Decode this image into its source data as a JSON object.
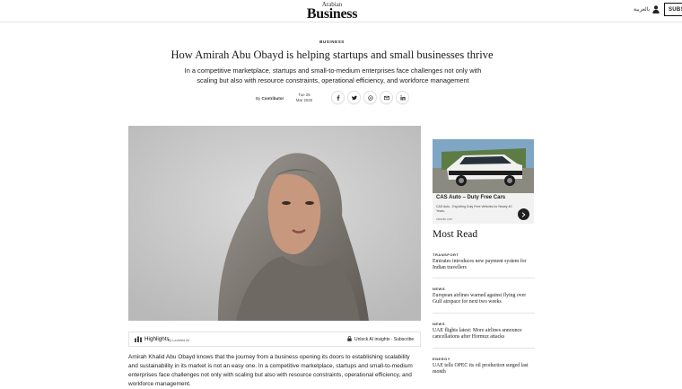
{
  "header": {
    "logo_line1": "Arabian",
    "logo_line2": "Business",
    "language_link": "بالعربية",
    "subscribe_label": "SUBS"
  },
  "article": {
    "category": "BUSINESS",
    "title": "How Amirah Abu Obayd is helping startups and small businesses thrive",
    "dek": "In a competitive marketplace, startups and small-to-medium enterprises face challenges not only with scaling but also with resource constraints, operational efficiency, and workforce management",
    "byline_prefix": "By",
    "author": "Contributor",
    "date_line1": "Tue 25",
    "date_line2": "Mar 2025",
    "share": [
      "facebook-icon",
      "twitter-icon",
      "whatsapp-icon",
      "email-icon",
      "linkedin-icon"
    ]
  },
  "highlights": {
    "label": "Highlights",
    "by": "by Leveled AI",
    "unlock": "Unlock AI insights · Subscribe"
  },
  "body_text": "Amirah Khalid Abu Obayd knows that the journey from a business opening its doors to establishing scalability and sustainability in its market is not an easy one. In a competitive marketplace, startups and small-to-medium enterprises face challenges not only with scaling but also with resource constraints, operational efficiency, and workforce management.",
  "ad": {
    "headline": "CAS Auto – Duty Free Cars",
    "body": "CAS Auto - Exporting Duty Free Vehicles for Nearly 40 Years.",
    "url": "casauto.com"
  },
  "most_read": {
    "heading": "Most Read",
    "items": [
      {
        "kicker": "TRANSPORT",
        "title": "Emirates introduces new payment system for Indian travellers"
      },
      {
        "kicker": "NEWS",
        "title": "European airlines warned against flying over Gulf airspace for next two weeks"
      },
      {
        "kicker": "NEWS",
        "title": "UAE flights latest: More airlines announce cancellations after Hormuz attacks"
      },
      {
        "kicker": "ENERGY",
        "title": "UAE tells OPEC its oil production surged last month"
      }
    ]
  },
  "colors": {
    "text": "#1a1a1a",
    "divider": "#e4e4e4",
    "ad_carousel": "#1f1f1f"
  }
}
